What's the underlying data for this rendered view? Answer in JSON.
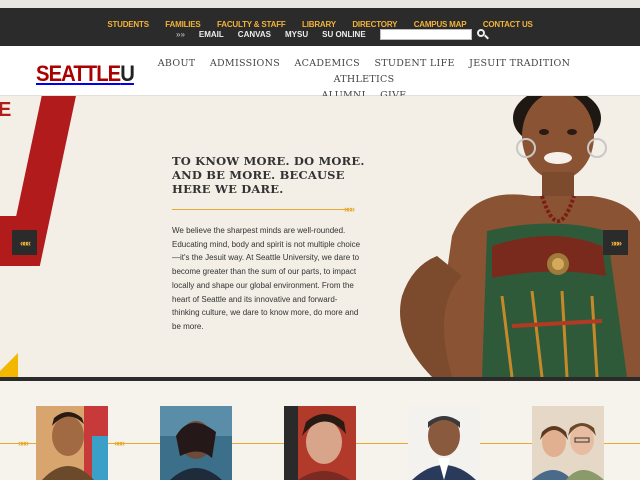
{
  "utility_nav": {
    "row1": [
      "STUDENTS",
      "FAMILIES",
      "FACULTY & STAFF",
      "LIBRARY",
      "DIRECTORY",
      "CAMPUS MAP",
      "CONTACT US"
    ],
    "row2_chevron": "»»",
    "row2": [
      "EMAIL",
      "CANVAS",
      "MYSU",
      "SU ONLINE"
    ],
    "search": {
      "value": "",
      "placeholder": ""
    }
  },
  "logo": {
    "seattle": "SEATTLE",
    "u": "U"
  },
  "main_nav": [
    "ABOUT",
    "ADMISSIONS",
    "ACADEMICS",
    "STUDENT LIFE",
    "JESUIT TRADITION",
    "ATHLETICS",
    "ALUMNI",
    "GIVE"
  ],
  "hero": {
    "decor_letter": "E",
    "headline": "TO KNOW MORE. DO MORE. AND BE MORE. BECAUSE HERE WE DARE.",
    "rule_chevrons": "»»»",
    "body": "We believe the sharpest minds are well-rounded. Educating mind, body and spirit is not multiple choice—it's the Jesuit way. At Seattle University, we dare to become greater than the sum of our parts, to impact locally and shape our global environment. From the heart of Seattle and its innovative and forward-thinking culture, we dare to know more, do more and be more.",
    "prev_label": "«««",
    "next_label": "»»»"
  },
  "profiles_strip": {
    "chevrons": "»»»",
    "thumbnails": [
      "student-portrait-1",
      "singer-portrait",
      "student-portrait-3",
      "faculty-portrait",
      "two-students-portrait"
    ]
  },
  "colors": {
    "brand_red": "#aa0000",
    "accent_gold": "#f2b23a",
    "dark_bar": "#2b2b2b",
    "hero_bg": "#f3efe6"
  }
}
